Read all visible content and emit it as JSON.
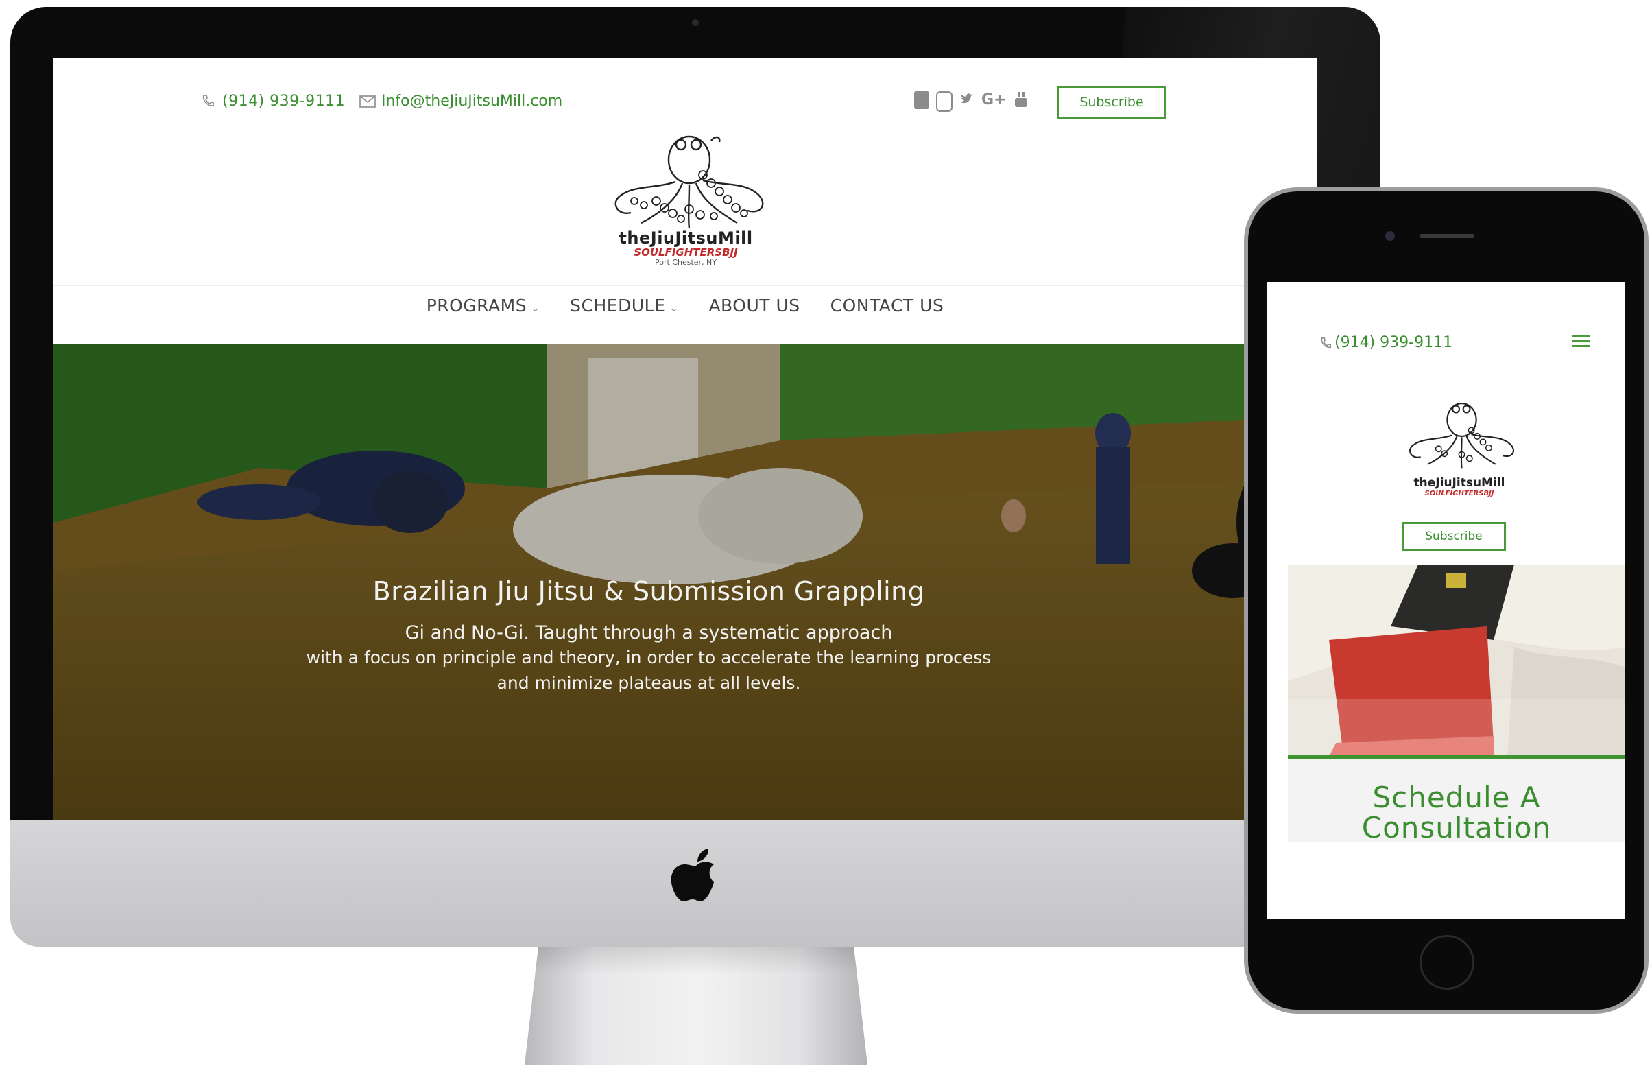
{
  "desktop": {
    "topbar": {
      "phone": "(914) 939-9111",
      "email": "Info@theJiuJitsuMill.com",
      "social_icons": [
        "facebook-icon",
        "instagram-icon",
        "twitter-icon",
        "google-plus-icon",
        "youtube-icon"
      ],
      "subscribe_label": "Subscribe"
    },
    "logo": {
      "name": "theJiuJitsuMill",
      "tagline": "SOULFIGHTERSBJJ",
      "location": "Port Chester, NY"
    },
    "nav": {
      "items": [
        {
          "label": "PROGRAMS",
          "has_dropdown": true
        },
        {
          "label": "SCHEDULE",
          "has_dropdown": true
        },
        {
          "label": "ABOUT US",
          "has_dropdown": false
        },
        {
          "label": "CONTACT US",
          "has_dropdown": false
        }
      ]
    },
    "hero": {
      "title": "Brazilian Jiu Jitsu & Submission Grappling",
      "line1": "Gi and No-Gi. Taught through a systematic approach",
      "line2": "with a focus on principle and theory, in order to accelerate the learning process",
      "line3": "and minimize plateaus at all levels."
    }
  },
  "mobile": {
    "phone": "(914) 939-9111",
    "menu_icon": "hamburger-menu-icon",
    "logo": {
      "name": "theJiuJitsuMill",
      "tagline": "SOULFIGHTERSBJJ"
    },
    "subscribe_label": "Subscribe",
    "section_title_line1": "Schedule A",
    "section_title_line2": "Consultation"
  },
  "colors": {
    "brand_green": "#3a8e2f",
    "logo_red": "#c22b2b",
    "nav_text": "#444444"
  }
}
